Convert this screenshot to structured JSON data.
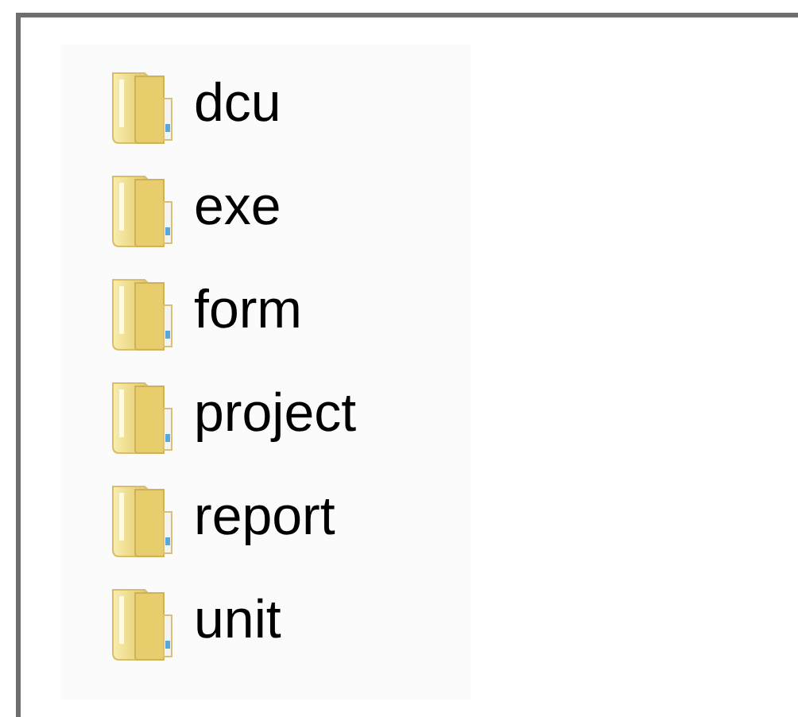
{
  "folders": [
    {
      "name": "dcu"
    },
    {
      "name": "exe"
    },
    {
      "name": "form"
    },
    {
      "name": "project"
    },
    {
      "name": "report"
    },
    {
      "name": "unit"
    }
  ]
}
